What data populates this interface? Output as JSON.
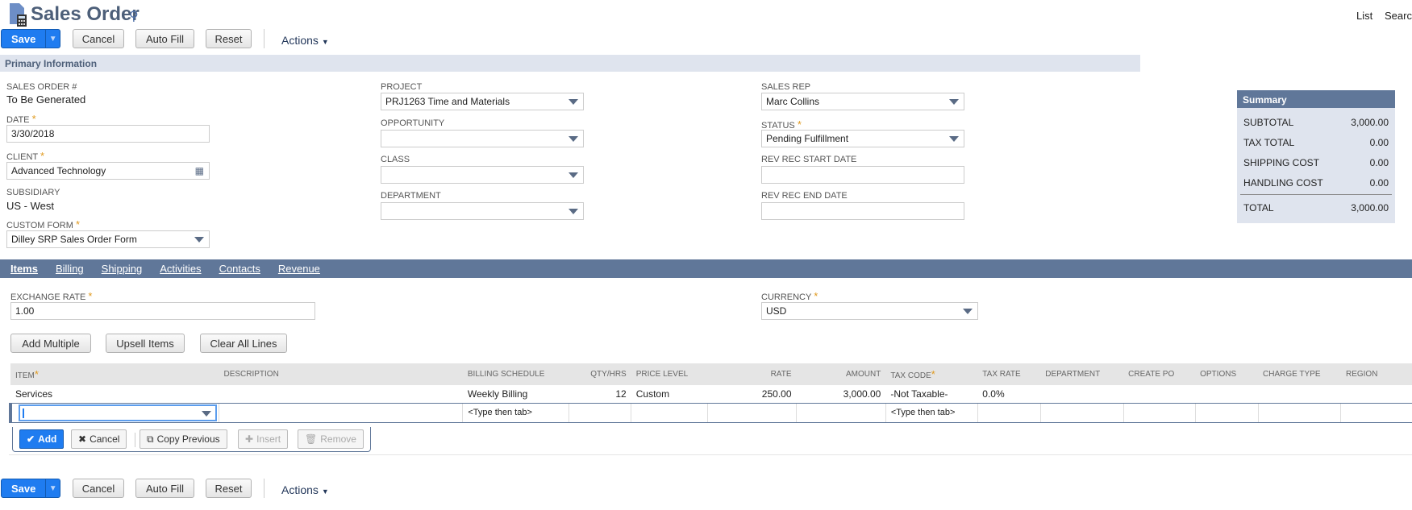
{
  "header": {
    "title": "Sales Order",
    "links": [
      "List",
      "Search"
    ]
  },
  "toolbar": {
    "save": "Save",
    "cancel": "Cancel",
    "autofill": "Auto Fill",
    "reset": "Reset",
    "actions": "Actions"
  },
  "primary": {
    "section": "Primary Information",
    "sales_order_label": "SALES ORDER #",
    "sales_order_value": "To Be Generated",
    "date_label": "DATE",
    "date_value": "3/30/2018",
    "client_label": "CLIENT",
    "client_value": "Advanced Technology",
    "subsidiary_label": "SUBSIDIARY",
    "subsidiary_value": "US - West",
    "custom_form_label": "CUSTOM FORM",
    "custom_form_value": "Dilley SRP Sales Order Form",
    "project_label": "PROJECT",
    "project_value": "PRJ1263 Time and Materials",
    "opportunity_label": "OPPORTUNITY",
    "opportunity_value": "",
    "class_label": "CLASS",
    "class_value": "",
    "department_label": "DEPARTMENT",
    "department_value": "",
    "sales_rep_label": "SALES REP",
    "sales_rep_value": "Marc Collins",
    "status_label": "STATUS",
    "status_value": "Pending Fulfillment",
    "rev_start_label": "REV REC START DATE",
    "rev_start_value": "",
    "rev_end_label": "REV REC END DATE",
    "rev_end_value": ""
  },
  "summary": {
    "title": "Summary",
    "rows": [
      {
        "label": "SUBTOTAL",
        "value": "3,000.00"
      },
      {
        "label": "TAX TOTAL",
        "value": "0.00"
      },
      {
        "label": "SHIPPING COST",
        "value": "0.00"
      },
      {
        "label": "HANDLING COST",
        "value": "0.00"
      }
    ],
    "total_label": "TOTAL",
    "total_value": "3,000.00"
  },
  "tabs": [
    "Items",
    "Billing",
    "Shipping",
    "Activities",
    "Contacts",
    "Revenue"
  ],
  "items": {
    "exchange_label": "EXCHANGE RATE",
    "exchange_value": "1.00",
    "currency_label": "CURRENCY",
    "currency_value": "USD",
    "add_multiple": "Add Multiple",
    "upsell": "Upsell Items",
    "clear_all": "Clear All Lines",
    "columns": [
      "ITEM",
      "DESCRIPTION",
      "BILLING SCHEDULE",
      "QTY/HRS",
      "PRICE LEVEL",
      "RATE",
      "AMOUNT",
      "TAX CODE",
      "TAX RATE",
      "DEPARTMENT",
      "CREATE PO",
      "OPTIONS",
      "CHARGE TYPE",
      "REGION"
    ],
    "rows": [
      [
        "Services",
        "",
        "Weekly Billing",
        "12",
        "Custom",
        "250.00",
        "3,000.00",
        "-Not Taxable-",
        "0.0%",
        "",
        "",
        "",
        "",
        ""
      ]
    ],
    "edit_hint": "<Type then tab>",
    "line_buttons": {
      "add": "Add",
      "cancel": "Cancel",
      "copy": "Copy Previous",
      "insert": "Insert",
      "remove": "Remove"
    }
  },
  "colors": {
    "accent": "#1f7cf0",
    "header_bar": "#607799",
    "section_bg": "#dfe4ee",
    "required": "#e09a20"
  }
}
